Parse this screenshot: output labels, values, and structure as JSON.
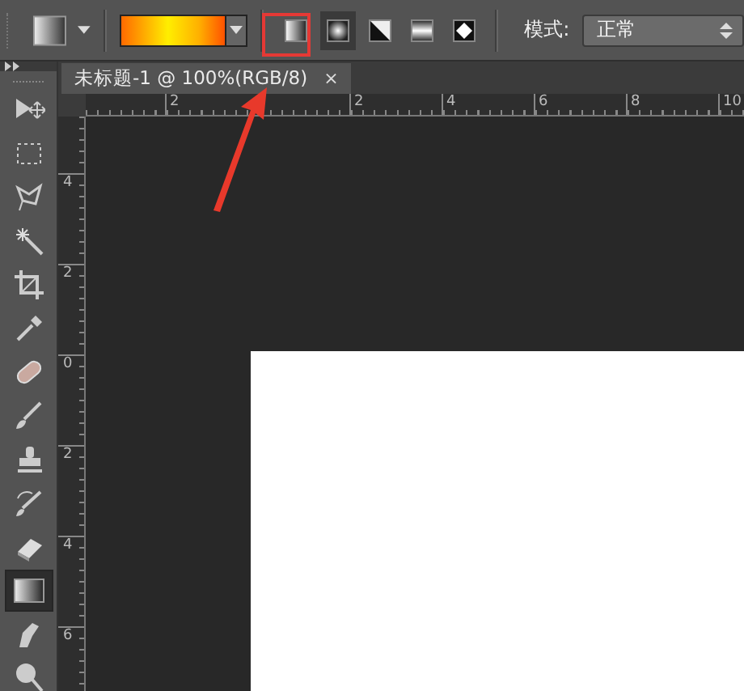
{
  "options_bar": {
    "gradient_types": [
      {
        "kind": "linear",
        "selected": false
      },
      {
        "kind": "radial",
        "selected": true
      },
      {
        "kind": "angle",
        "selected": false
      },
      {
        "kind": "reflected",
        "selected": false
      },
      {
        "kind": "diamond",
        "selected": false
      }
    ],
    "mode_label": "模式:",
    "mode_value": "正常"
  },
  "tools": [
    {
      "kind": "move",
      "selected": false
    },
    {
      "kind": "marquee",
      "selected": false
    },
    {
      "kind": "lasso",
      "selected": false
    },
    {
      "kind": "wand",
      "selected": false
    },
    {
      "kind": "crop",
      "selected": false
    },
    {
      "kind": "eyedropper",
      "selected": false
    },
    {
      "kind": "bandage",
      "selected": false
    },
    {
      "kind": "brush",
      "selected": false
    },
    {
      "kind": "stamp",
      "selected": false
    },
    {
      "kind": "history",
      "selected": false
    },
    {
      "kind": "eraser",
      "selected": false
    },
    {
      "kind": "gradient",
      "selected": true
    },
    {
      "kind": "smudge",
      "selected": false
    },
    {
      "kind": "dodge",
      "selected": false
    }
  ],
  "document_tab": {
    "title": "未标题-1 @ 100%(RGB/8)",
    "close": "×"
  },
  "horizontal_ruler": [
    "2",
    "2",
    "4",
    "6",
    "8",
    "10"
  ],
  "vertical_ruler": [
    "4",
    "2",
    "0",
    "2",
    "4",
    "6"
  ]
}
